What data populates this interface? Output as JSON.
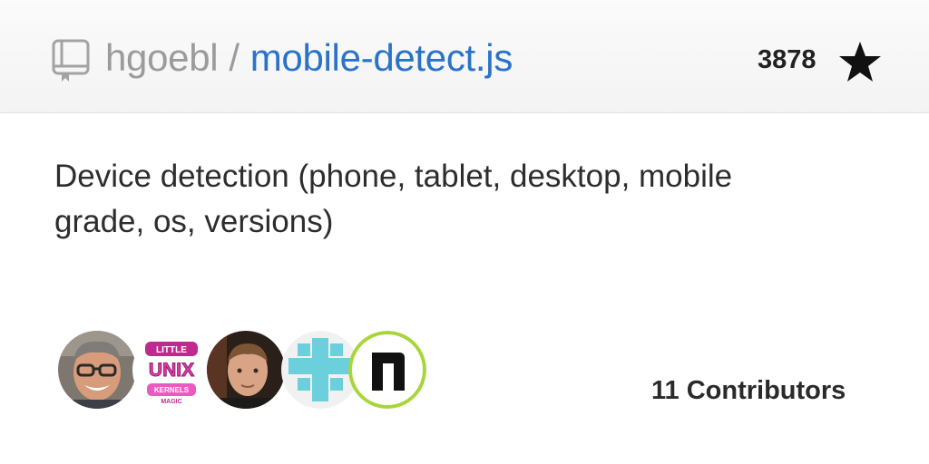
{
  "repo": {
    "owner": "hgoebl",
    "separator": "/",
    "name": "mobile-detect.js",
    "star_count": "3878",
    "description": "Device detection (phone, tablet, desktop, mobile grade, os, versions)"
  },
  "avatar_text": {
    "little": "LITTLE",
    "unix": "UNIX",
    "kernels": "KERNELS",
    "magic": "MAGIC"
  },
  "contributors": {
    "label": "11 Contributors"
  },
  "icons": {
    "repo": "repo-icon",
    "star": "star-icon"
  },
  "colors": {
    "repo_link": "#2b73c9",
    "owner_text": "#9b9b9b",
    "header_bg": "#f5f5f5"
  }
}
